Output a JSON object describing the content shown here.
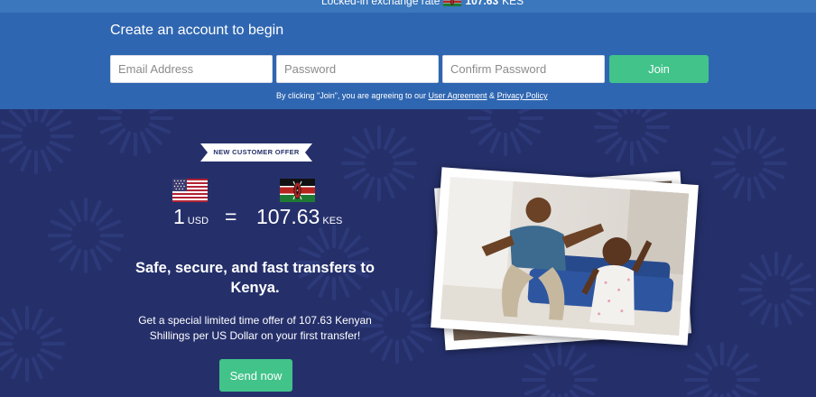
{
  "top_strip": {
    "rate_label": "Locked-in exchange rate",
    "rate_value": "107.63",
    "rate_currency": "KES"
  },
  "signup": {
    "title": "Create an account to begin",
    "email_placeholder": "Email Address",
    "password_placeholder": "Password",
    "confirm_placeholder": "Confirm Password",
    "join_label": "Join",
    "terms_prefix": "By clicking \"Join\", you are agreeing to our",
    "user_agreement_label": "User Agreement",
    "terms_and": "&",
    "privacy_policy_label": "Privacy Policy"
  },
  "offer": {
    "ribbon_label": "NEW CUSTOMER OFFER",
    "from_amount": "1",
    "from_currency": "USD",
    "equals": "=",
    "to_amount": "107.63",
    "to_currency": "KES",
    "headline": "Safe, secure, and fast transfers to Kenya.",
    "description": "Get a special limited time offer of 107.63 Kenyan Shillings per US Dollar on your first transfer!",
    "send_label": "Send now"
  },
  "colors": {
    "top_strip": "#3a77bd",
    "signup_band": "#2f66b1",
    "hero_background": "#25306b",
    "accent_green": "#41c38a"
  },
  "icons": {
    "from_flag": "us-flag-icon",
    "to_flag": "kenya-flag-icon"
  }
}
